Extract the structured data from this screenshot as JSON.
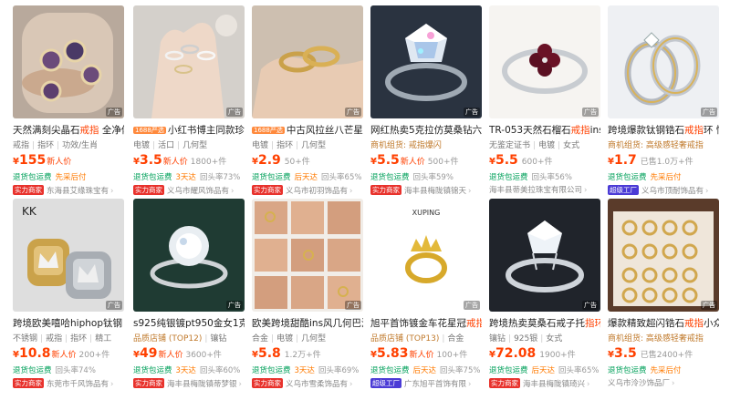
{
  "colors": {
    "accent": "#ff4000",
    "service_green": "#00a05a",
    "service_orange": "#ff7a00",
    "merchant_red": "#e8322c",
    "factory_purple": "#4b3bd6"
  },
  "products": [
    {
      "title_pre": "天然满刻尖晶石",
      "title_hl": "戒指",
      "title_post": " 全净体",
      "attrs": [
        "戒指",
        "指环",
        "功效/生肖"
      ],
      "price_int": "155",
      "price_label": "新人价",
      "sales": "",
      "services": [
        "退货包运费",
        "先采后付"
      ],
      "shop_tag": "实力商家",
      "shop": "东海县艾缘珠宝有",
      "img": "stones"
    },
    {
      "title_tag": "1688严选",
      "title_pre": "小红书博主同款珍珠",
      "attrs": [
        "电镀",
        "活口",
        "几何型"
      ],
      "price_int": "3.5",
      "price_label": "新人价",
      "sales": "1800+件",
      "services": [
        "退货包运费",
        "3天达",
        "回头率73%"
      ],
      "shop_tag": "实力商家",
      "shop": "义乌市耀风饰品有",
      "img": "hand-rings"
    },
    {
      "title_tag": "1688严选",
      "title_pre": "中古风拉丝八芒星",
      "title_hl": "戒",
      "attrs": [
        "电镀",
        "指环",
        "几何型"
      ],
      "price_int": "2.9",
      "price_label": "",
      "sales": "50+件",
      "services": [
        "退货包运费",
        "后天达",
        "回头率65%"
      ],
      "shop_tag": "实力商家",
      "shop": "义乌市初羽饰品有",
      "img": "gold-pair"
    },
    {
      "title_pre": "网红热卖5克拉仿莫桑钻六",
      "attrs_badge": "商机组货: 戒指爆闪",
      "price_int": "5.5",
      "price_label": "新人价",
      "sales": "500+件",
      "services": [
        "退货包运费",
        "回头率59%"
      ],
      "shop_tag": "实力商家",
      "shop": "海丰县梅陇镇锦天",
      "img": "diamond"
    },
    {
      "title_pre": "TR-053天然石榴石",
      "title_hl": "戒指",
      "title_post": "ins",
      "attrs": [
        "无鉴定证书",
        "电镀",
        "女式"
      ],
      "price_int": "5.5",
      "price_label": "",
      "sales": "600+件",
      "services": [
        "退货包运费",
        "回头率56%"
      ],
      "shop_tag": "",
      "shop": "海丰县蒂美拉珠宝有限公司",
      "img": "garnet"
    },
    {
      "title_pre": "跨境爆款钛钢锆石",
      "title_hl": "戒指",
      "title_post": "环 情",
      "attrs_badge": "商机组货: 高级感轻奢戒指",
      "price_int": "1.7",
      "price_label": "",
      "sales": "已售1.0万+件",
      "services": [
        "退货包运费",
        "先采后付"
      ],
      "shop_tag": "超级工厂",
      "shop": "义乌市顶耐饰品有",
      "img": "couple"
    },
    {
      "title_pre": "跨境欧美嘻哈hiphop钛钢",
      "attrs": [
        "不锈钢",
        "戒指",
        "指环",
        "精工"
      ],
      "price_int": "10.8",
      "price_label": "新人价",
      "sales": "200+件",
      "services": [
        "退货包运费",
        "回头率74%"
      ],
      "shop_tag": "实力商家",
      "shop": "东莞市千风饰品有",
      "img": "crown"
    },
    {
      "title_pre": "s925纯银镀pt950金女1克",
      "attrs_badge": "品质店铺 (TOP12)",
      "attrs": [
        "镶钻"
      ],
      "price_int": "49",
      "price_label": "新人价",
      "sales": "3600+件",
      "services": [
        "退货包运费",
        "3天达",
        "回头率60%"
      ],
      "shop_tag": "实力商家",
      "shop": "海丰县梅陇镇蒂梦银",
      "img": "halo"
    },
    {
      "title_pre": "欧美跨境甜酷ins风几何巴洛",
      "attrs": [
        "合金",
        "电镀",
        "几何型"
      ],
      "price_int": "5.8",
      "price_label": "",
      "sales": "1.2万+件",
      "services": [
        "退货包运费",
        "3天达",
        "回头率69%"
      ],
      "shop_tag": "实力商家",
      "shop": "义乌市雪柔饰品有",
      "img": "grid-hands"
    },
    {
      "title_pre": "旭平首饰镀金车花星冠",
      "title_hl": "戒指",
      "attrs_badge": "品质店铺 (TOP13)",
      "attrs": [
        "合金"
      ],
      "price_int": "5.83",
      "price_label": "新人价",
      "sales": "100+件",
      "services": [
        "退货包运费",
        "后天达",
        "回头率75%"
      ],
      "shop_tag": "超级工厂",
      "shop": "广东旭平首饰有限",
      "img": "xuping",
      "brand": "XUPING"
    },
    {
      "title_pre": "跨境热卖莫桑石戒子托",
      "title_hl": "指环",
      "attrs": [
        "镶钻",
        "925银",
        "女式"
      ],
      "price_int": "72.08",
      "price_label": "",
      "sales": "1900+件",
      "services": [
        "退货包运费",
        "后天达",
        "回头率65%"
      ],
      "shop_tag": "实力商家",
      "shop": "海丰县梅陇镇琦兴",
      "img": "solitaire"
    },
    {
      "title_pre": "爆款精致超闪锆石",
      "title_hl": "戒指",
      "title_post": "小众",
      "attrs_badge": "商机组货: 高级感轻奢戒指",
      "price_int": "3.5",
      "price_label": "",
      "sales": "已售2400+件",
      "services": [
        "退货包运费",
        "先采后付"
      ],
      "shop_tag": "",
      "shop": "义乌市泠沙饰品厂",
      "img": "tray"
    }
  ]
}
